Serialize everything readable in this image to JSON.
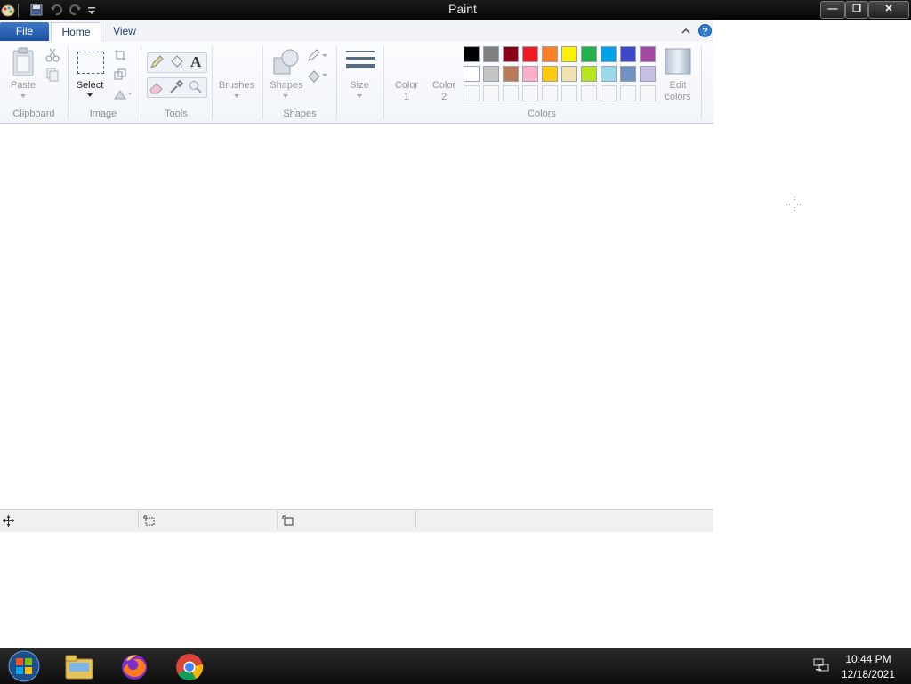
{
  "window": {
    "title": "Paint",
    "controls": {
      "minimize": "—",
      "restore": "❐",
      "close": "✕"
    }
  },
  "ribbon": {
    "tabs": {
      "file": "File",
      "home": "Home",
      "view": "View"
    },
    "clipboard": {
      "paste_label": "Paste",
      "group_label": "Clipboard"
    },
    "image": {
      "select_label": "Select",
      "group_label": "Image"
    },
    "tools": {
      "group_label": "Tools",
      "text_glyph": "A"
    },
    "brushes": {
      "label": "Brushes"
    },
    "shapes": {
      "label": "Shapes",
      "group_label": "Shapes"
    },
    "size": {
      "label": "Size"
    },
    "colors": {
      "color1_label_line1": "Color",
      "color1_label_line2": "1",
      "color2_label_line1": "Color",
      "color2_label_line2": "2",
      "group_label": "Colors",
      "edit_label_line1": "Edit",
      "edit_label_line2": "colors",
      "row1": [
        "#000000",
        "#7f7f7f",
        "#880015",
        "#ed1c24",
        "#ff7f27",
        "#fff200",
        "#22b14c",
        "#00a2e8",
        "#3f48cc",
        "#a349a4"
      ],
      "row2": [
        "#ffffff",
        "#c3c3c3",
        "#b97a57",
        "#ffaec9",
        "#ffc90e",
        "#efe4b0",
        "#b5e61d",
        "#99d9ea",
        "#7092be",
        "#c8bfe7"
      ]
    }
  },
  "taskbar": {
    "apps": [
      "start-button",
      "file-explorer",
      "firefox",
      "chrome"
    ],
    "time": "10:44 PM",
    "date": "12/18/2021"
  }
}
